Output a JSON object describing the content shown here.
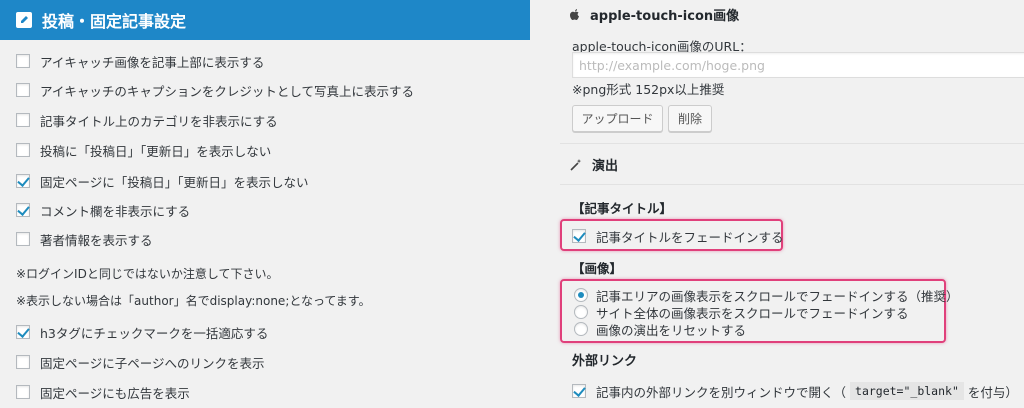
{
  "left": {
    "header": {
      "title": "投稿・固定記事設定"
    },
    "options": [
      {
        "label": "アイキャッチ画像を記事上部に表示する",
        "checked": false
      },
      {
        "label": "アイキャッチのキャプションをクレジットとして写真上に表示する",
        "checked": false
      },
      {
        "label": "記事タイトル上のカテゴリを非表示にする",
        "checked": false
      },
      {
        "label": "投稿に「投稿日」「更新日」を表示しない",
        "checked": false
      },
      {
        "label": "固定ページに「投稿日」「更新日」を表示しない",
        "checked": true
      },
      {
        "label": "コメント欄を非表示にする",
        "checked": true
      },
      {
        "label": "著者情報を表示する",
        "checked": false
      }
    ],
    "notes": [
      "※ログインIDと同じではないか注意して下さい。",
      "※表示しない場合は「author」名でdisplay:none;となってます。"
    ],
    "options2": [
      {
        "label": "h3タグにチェックマークを一括適応する",
        "checked": true
      },
      {
        "label": "固定ページに子ページへのリンクを表示",
        "checked": false
      },
      {
        "label": "固定ページにも広告を表示",
        "checked": false
      }
    ]
  },
  "right": {
    "apple_section": {
      "title": "apple-touch-icon画像",
      "url_label": "apple-touch-icon画像のURL：",
      "url_placeholder": "http://example.com/hoge.png",
      "url_value": "",
      "hint": "※png形式 152px以上推奨",
      "upload_button": "アップロード",
      "delete_button": "削除"
    },
    "effects_section": {
      "title": "演出",
      "article_title_heading": "【記事タイトル】",
      "article_title_option": {
        "label": "記事タイトルをフェードインする",
        "checked": true
      },
      "image_heading": "【画像】",
      "image_options": [
        {
          "label": "記事エリアの画像表示をスクロールでフェードインする（推奨）",
          "checked": true
        },
        {
          "label": "サイト全体の画像表示をスクロールでフェードインする",
          "checked": false
        },
        {
          "label": "画像の演出をリセットする",
          "checked": false
        }
      ]
    },
    "external_links": {
      "title": "外部リンク",
      "option_before": "記事内の外部リンクを別ウィンドウで開く（",
      "option_code": "target=\"_blank\"",
      "option_after": "を付与）",
      "checked": true
    }
  },
  "colors": {
    "header_bg": "#1e87c8",
    "highlight": "#e0407b",
    "check": "#1e8cbe"
  }
}
